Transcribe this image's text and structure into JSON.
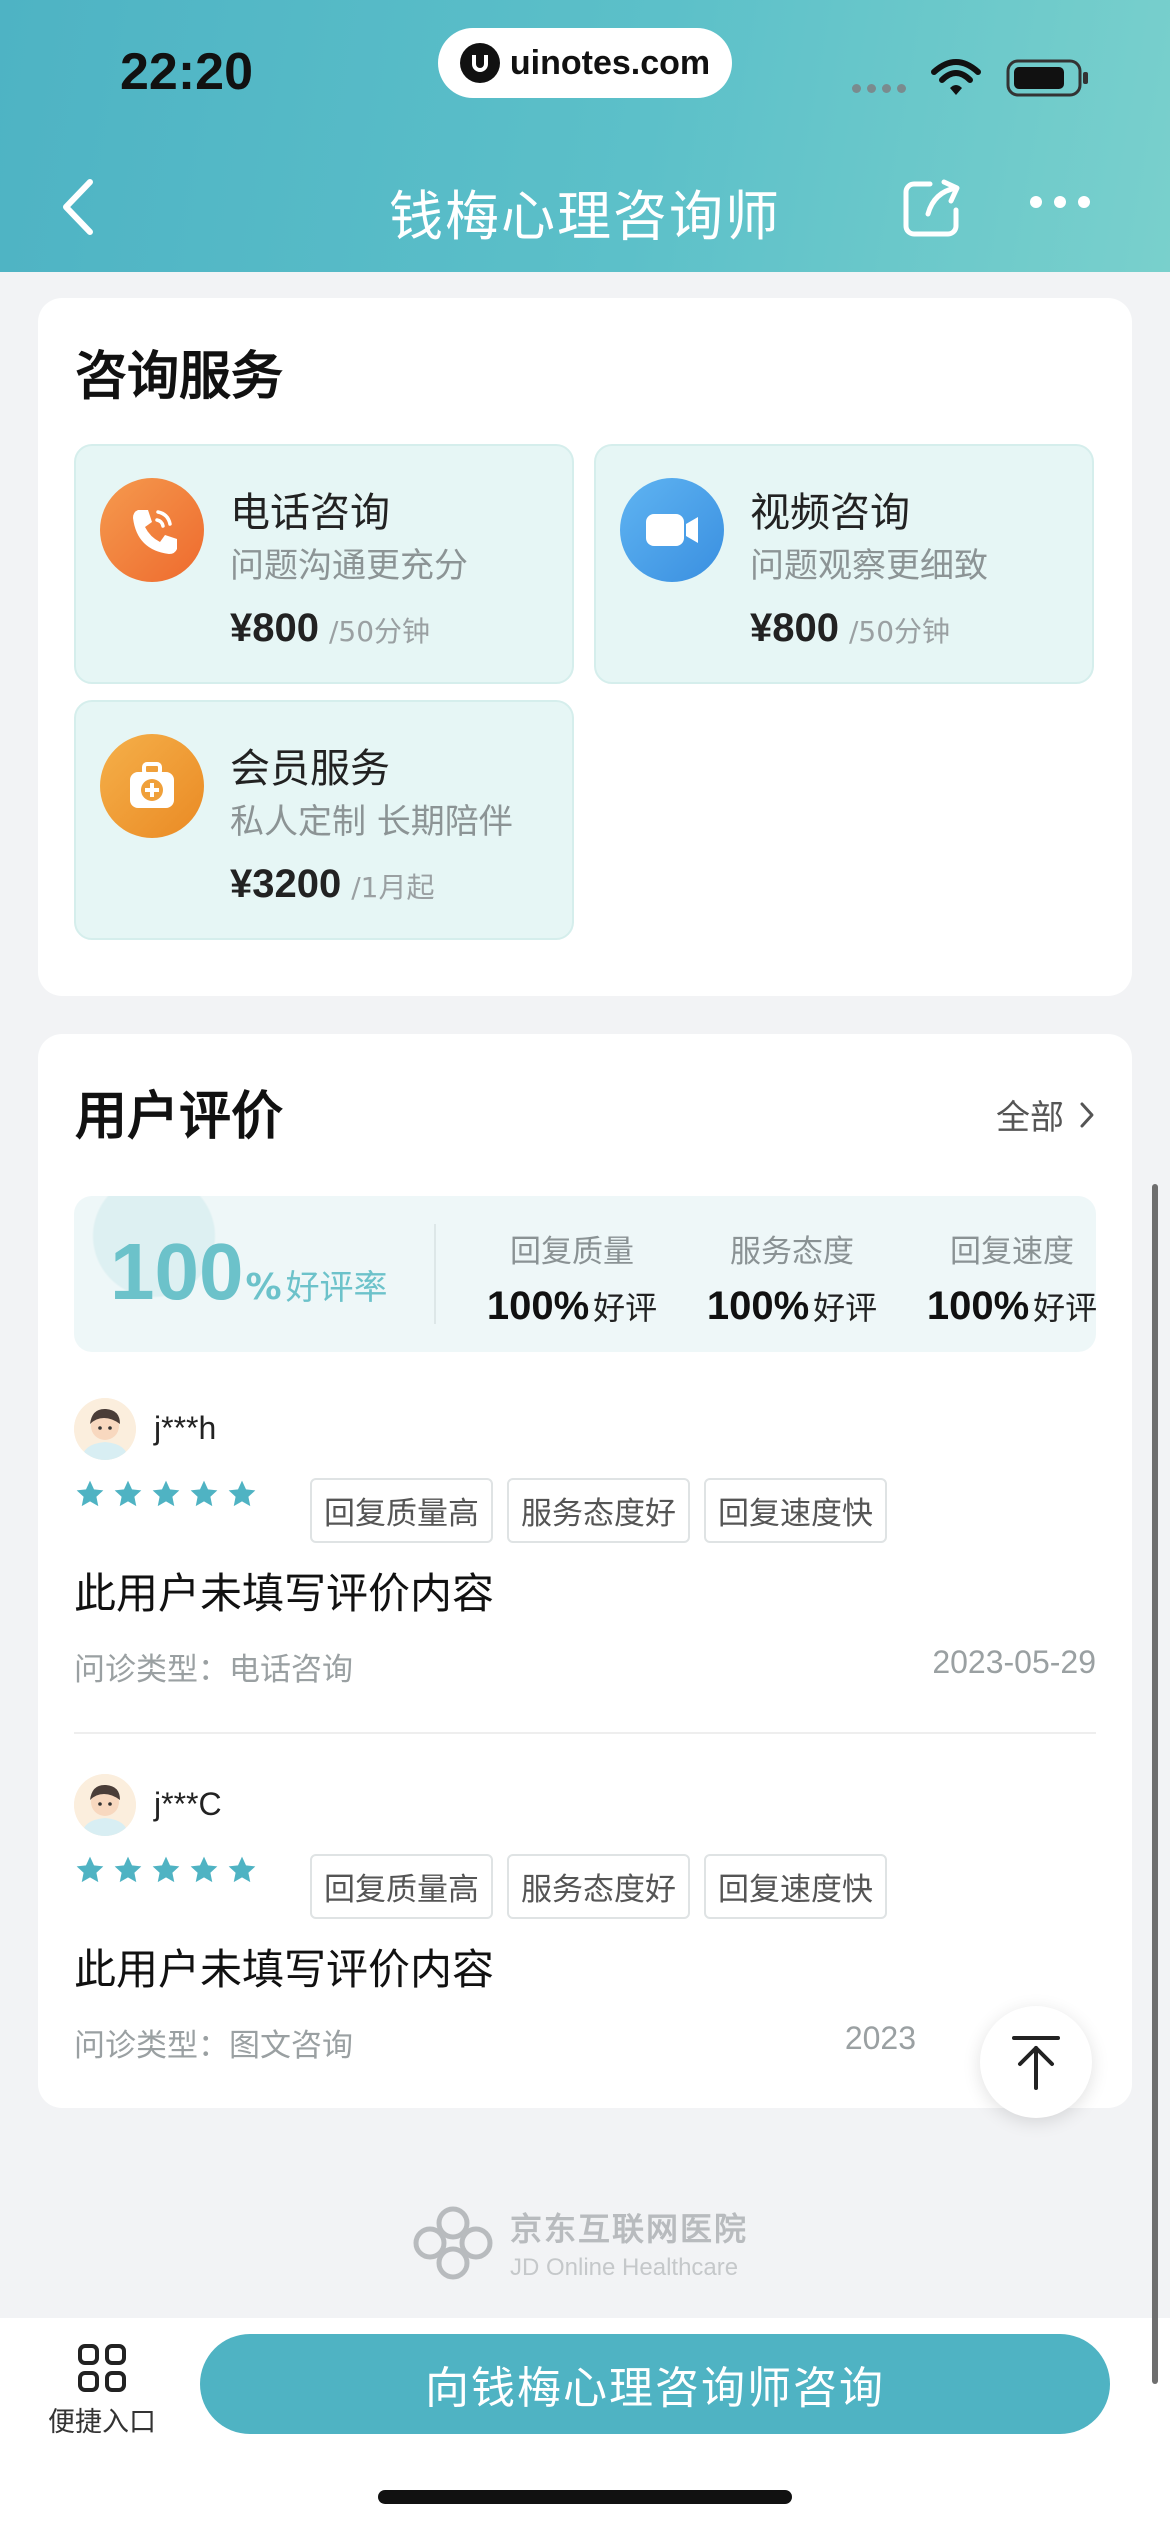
{
  "status_bar": {
    "time": "22:20",
    "url": "uinotes.com"
  },
  "nav": {
    "title": "钱梅心理咨询师"
  },
  "services": {
    "title": "咨询服务",
    "items": [
      {
        "name": "电话咨询",
        "desc": "问题沟通更充分",
        "price": "¥800",
        "unit": "/50分钟",
        "icon": "phone-icon",
        "color": "#f07a3a"
      },
      {
        "name": "视频咨询",
        "desc": "问题观察更细致",
        "price": "¥800",
        "unit": "/50分钟",
        "icon": "video-camera-icon",
        "color": "#3c9ce8"
      },
      {
        "name": "会员服务",
        "desc": "私人定制 长期陪伴",
        "price": "¥3200",
        "unit": "/1月起",
        "icon": "medical-kit-icon",
        "color": "#ef9a2f"
      }
    ]
  },
  "reviews": {
    "title": "用户评价",
    "all_label": "全部",
    "summary": {
      "rate_value": "100",
      "rate_pct": "%",
      "rate_label": "好评率",
      "metrics": [
        {
          "label": "回复质量",
          "value": "100%",
          "suffix": "好评"
        },
        {
          "label": "服务态度",
          "value": "100%",
          "suffix": "好评"
        },
        {
          "label": "回复速度",
          "value": "100%",
          "suffix": "好评"
        }
      ]
    },
    "items": [
      {
        "user": "j***h",
        "stars": 5,
        "tags": [
          "回复质量高",
          "服务态度好",
          "回复速度快"
        ],
        "content": "此用户未填写评价内容",
        "type": "问诊类型：电话咨询",
        "date": "2023-05-29"
      },
      {
        "user": "j***C",
        "stars": 5,
        "tags": [
          "回复质量高",
          "服务态度好",
          "回复速度快"
        ],
        "content": "此用户未填写评价内容",
        "type": "问诊类型：图文咨询",
        "date": "2023"
      }
    ]
  },
  "footer": {
    "logo_cn": "京东互联网医院",
    "logo_en": "JD Online Healthcare"
  },
  "bottom_bar": {
    "quick_entry_label": "便捷入口",
    "consult_button": "向钱梅心理咨询师咨询"
  },
  "colors": {
    "accent": "#4fb3c3",
    "star": "#4fb3c3",
    "rate": "#6cc2ca"
  }
}
